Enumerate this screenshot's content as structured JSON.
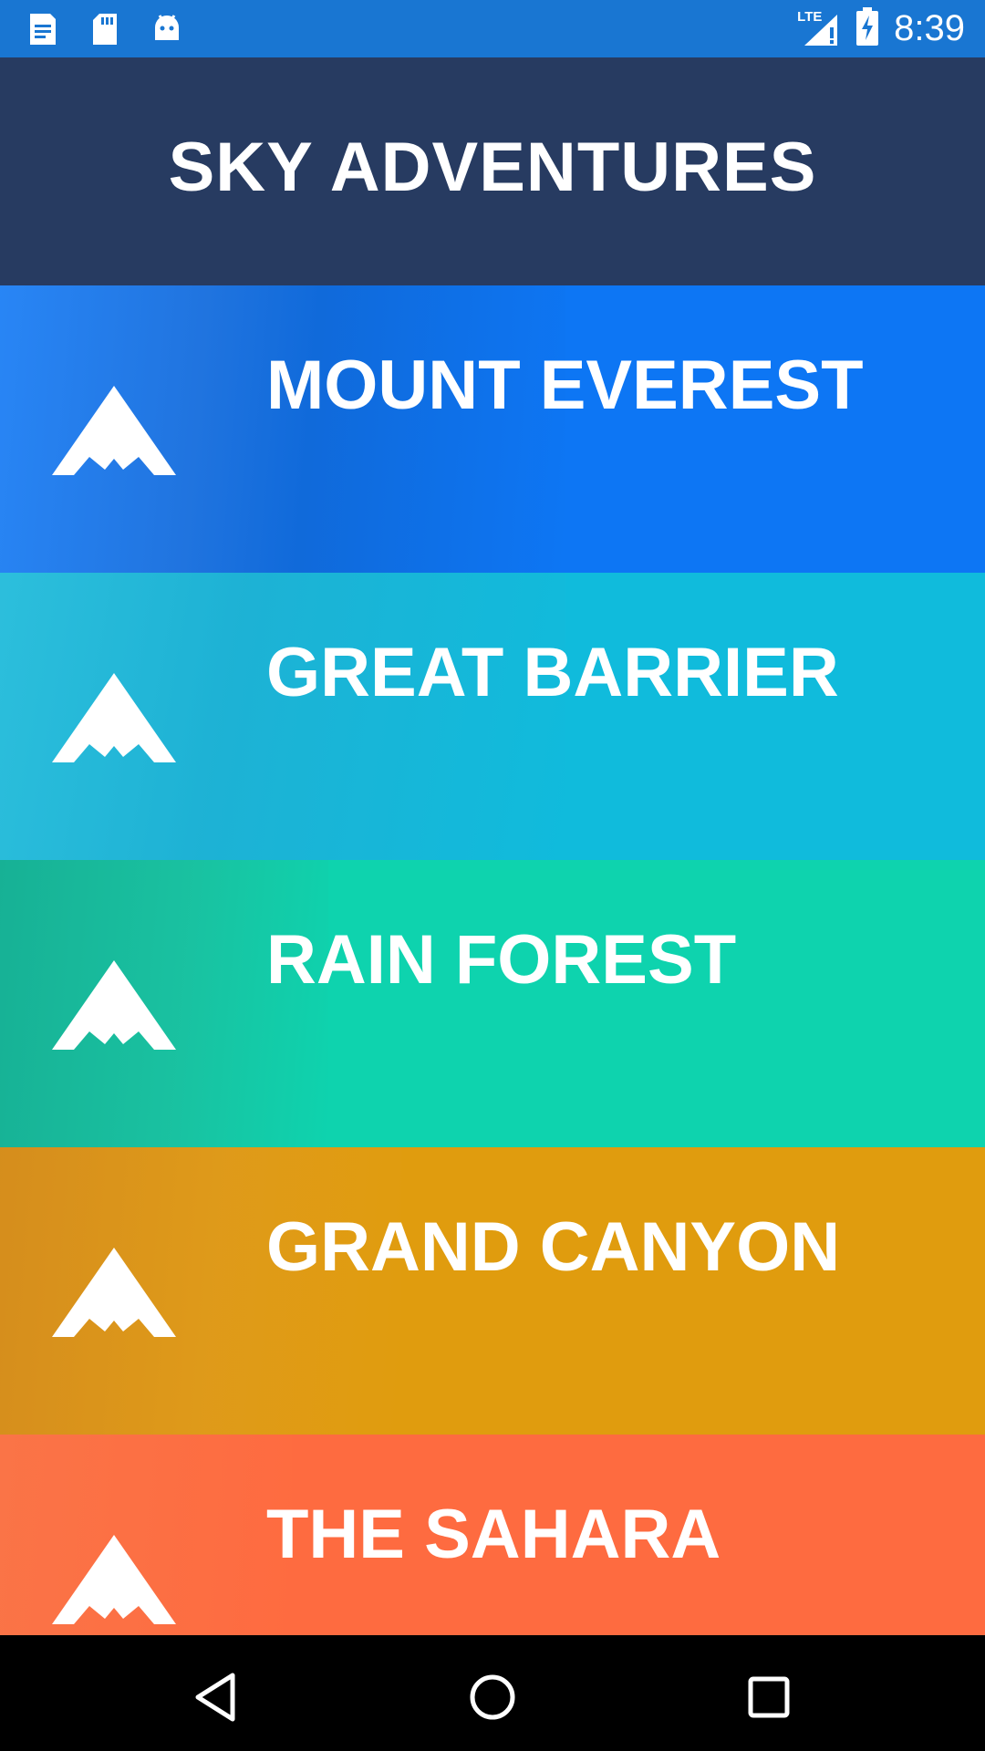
{
  "status_bar": {
    "left_icons": [
      "document-icon",
      "sd-card-icon",
      "android-icon"
    ],
    "network": "LTE",
    "time": "8:39"
  },
  "app": {
    "title": "SKY ADVENTURES"
  },
  "destinations": [
    {
      "name": "MOUNT EVEREST",
      "color": "#0D76F4"
    },
    {
      "name": "GREAT BARRIER",
      "color": "#10BBDC"
    },
    {
      "name": "RAIN FOREST",
      "color": "#0ED3AE"
    },
    {
      "name": "GRAND CANYON",
      "color": "#E09C0E"
    },
    {
      "name": "THE SAHARA",
      "color": "#FE6B40"
    }
  ],
  "nav_bar": {
    "buttons": [
      "back-icon",
      "home-icon",
      "recents-icon"
    ]
  }
}
